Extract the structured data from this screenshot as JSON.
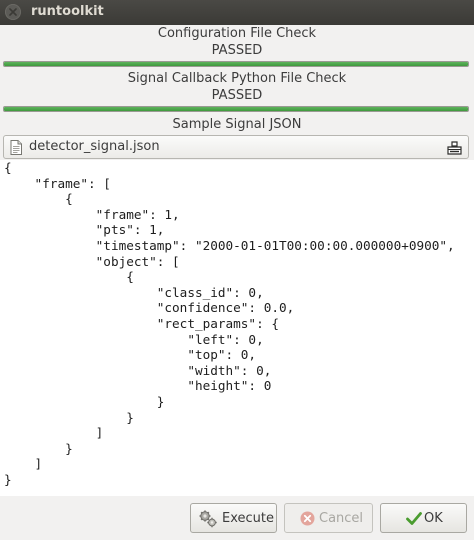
{
  "window": {
    "title": "runtoolkit"
  },
  "config_check": {
    "label": "Configuration File Check",
    "status": "PASSED",
    "progress": 1.0
  },
  "callback_check": {
    "label": "Signal Callback Python File Check",
    "status": "PASSED",
    "progress": 1.0
  },
  "sample_signal": {
    "label": "Sample Signal JSON",
    "file_name": "detector_signal.json",
    "json_text": "{\n    \"frame\": [\n        {\n            \"frame\": 1,\n            \"pts\": 1,\n            \"timestamp\": \"2000-01-01T00:00:00.000000+0900\",\n            \"object\": [\n                {\n                    \"class_id\": 0,\n                    \"confidence\": 0.0,\n                    \"rect_params\": {\n                        \"left\": 0,\n                        \"top\": 0,\n                        \"width\": 0,\n                        \"height\": 0\n                    }\n                }\n            ]\n        }\n    ]\n}"
  },
  "buttons": {
    "execute": "Execute",
    "cancel": "Cancel",
    "ok": "OK"
  },
  "icons": {
    "close": "close-icon",
    "file": "file-icon",
    "open": "open-file-icon",
    "execute": "gears-icon",
    "cancel": "cancel-icon",
    "ok": "checkmark-icon"
  },
  "colors": {
    "titlebar": "#3b3a36",
    "progress_fill": "#4ea94c",
    "cancel_icon": "#d68c82",
    "ok_icon": "#4a9c2f"
  }
}
